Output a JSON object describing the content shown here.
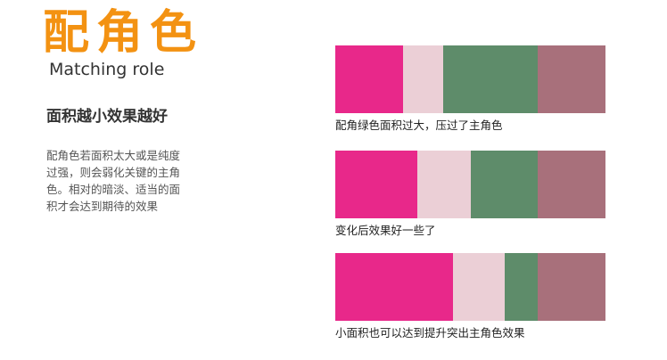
{
  "header": {
    "title": "配角色",
    "subtitle": "Matching role"
  },
  "intro": {
    "heading": "面积越小效果越好",
    "lines": [
      "配角色若面积太大或是纯度",
      "过强，则会弱化关键的主角",
      "色。相对的暗淡、适当的面",
      "积才会达到期待的效果"
    ]
  },
  "colors": {
    "accent": "#f39212",
    "main_role": "#e8288a",
    "light_pink": "#ebcfd6",
    "green": "#5e8c6a",
    "mauve": "#a8707b"
  },
  "examples": [
    {
      "caption": "配角绿色面积过大，压过了主角色",
      "segments": [
        {
          "color": "#e8288a",
          "share": 0.25
        },
        {
          "color": "#ebcfd6",
          "share": 0.148
        },
        {
          "color": "#5e8c6a",
          "share": 0.352
        },
        {
          "color": "#a8707b",
          "share": 0.25
        }
      ]
    },
    {
      "caption": "变化后效果好一些了",
      "segments": [
        {
          "color": "#e8288a",
          "share": 0.305
        },
        {
          "color": "#ebcfd6",
          "share": 0.197
        },
        {
          "color": "#5e8c6a",
          "share": 0.248
        },
        {
          "color": "#a8707b",
          "share": 0.25
        }
      ]
    },
    {
      "caption": "小面积也可以达到提升突出主角色效果",
      "segments": [
        {
          "color": "#e8288a",
          "share": 0.436
        },
        {
          "color": "#ebcfd6",
          "share": 0.19
        },
        {
          "color": "#5e8c6a",
          "share": 0.124
        },
        {
          "color": "#a8707b",
          "share": 0.25
        }
      ]
    }
  ]
}
